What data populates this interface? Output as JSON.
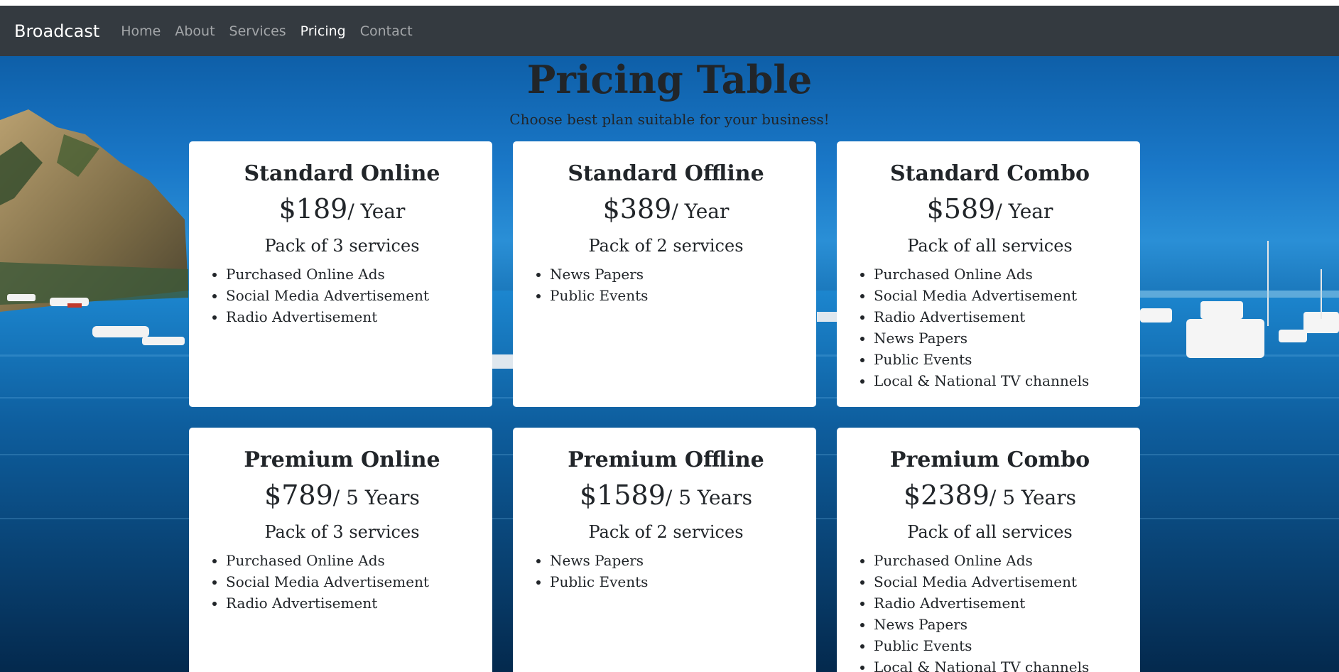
{
  "navbar": {
    "brand": "Broadcast",
    "items": [
      {
        "label": "Home",
        "active": false
      },
      {
        "label": "About",
        "active": false
      },
      {
        "label": "Services",
        "active": false
      },
      {
        "label": "Pricing",
        "active": true
      },
      {
        "label": "Contact",
        "active": false
      }
    ]
  },
  "header": {
    "title": "Pricing Table",
    "subtitle": "Choose best plan suitable for your business!"
  },
  "plans": [
    {
      "name": "Standard Online",
      "price": "$189",
      "period": "/ Year",
      "pack": "Pack of 3 services",
      "features": [
        "Purchased Online Ads",
        "Social Media Advertisement",
        "Radio Advertisement"
      ]
    },
    {
      "name": "Standard Offline",
      "price": "$389",
      "period": "/ Year",
      "pack": "Pack of 2 services",
      "features": [
        "News Papers",
        "Public Events"
      ]
    },
    {
      "name": "Standard Combo",
      "price": "$589",
      "period": "/ Year",
      "pack": "Pack of all services",
      "features": [
        "Purchased Online Ads",
        "Social Media Advertisement",
        "Radio Advertisement",
        "News Papers",
        "Public Events",
        "Local & National TV channels"
      ]
    },
    {
      "name": "Premium Online",
      "price": "$789",
      "period": "/ 5 Years",
      "pack": "Pack of 3 services",
      "features": [
        "Purchased Online Ads",
        "Social Media Advertisement",
        "Radio Advertisement"
      ]
    },
    {
      "name": "Premium Offline",
      "price": "$1589",
      "period": "/ 5 Years",
      "pack": "Pack of 2 services",
      "features": [
        "News Papers",
        "Public Events"
      ]
    },
    {
      "name": "Premium Combo",
      "price": "$2389",
      "period": "/ 5 Years",
      "pack": "Pack of all services",
      "features": [
        "Purchased Online Ads",
        "Social Media Advertisement",
        "Radio Advertisement",
        "News Papers",
        "Public Events",
        "Local & National TV channels"
      ]
    }
  ],
  "colors": {
    "navbar_bg": "#343a40",
    "card_bg": "#ffffff",
    "text": "#212529"
  }
}
